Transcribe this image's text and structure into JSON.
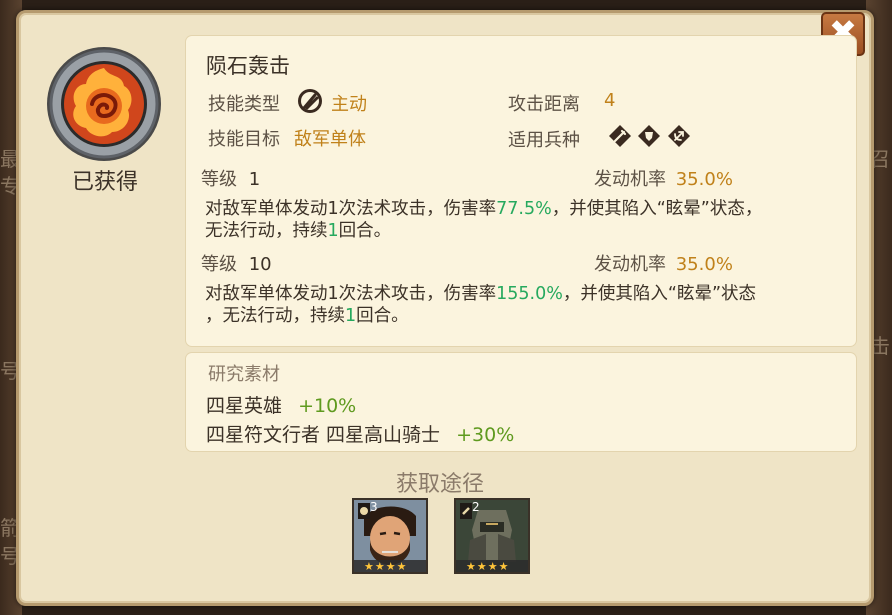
{
  "background": {
    "left_glyphs": [
      "最",
      "专",
      "号",
      "箭",
      "号"
    ],
    "right_glyphs": [
      "召",
      "击"
    ]
  },
  "close": {
    "label": "✖"
  },
  "skill": {
    "status": "已获得",
    "name": "陨石轰击",
    "type_label": "技能类型",
    "type_value": "主动",
    "range_label": "攻击距离",
    "range_value": "4",
    "target_label": "技能目标",
    "target_value": "敌军单体",
    "unit_label": "适用兵种",
    "unit_icons": [
      "sword-icon",
      "shield-icon",
      "bow-icon"
    ]
  },
  "levels": [
    {
      "level_label": "等级",
      "level_value": "1",
      "chance_label": "发动机率",
      "chance_value": "35.0%",
      "desc_a": "对敌军单体发动1次法术攻击，伤害率",
      "desc_rate": "77.5%",
      "desc_b": "，并使其陷入“眩晕”状态，",
      "desc_c": "无法行动，持续",
      "desc_turns": "1",
      "desc_d": "回合。"
    },
    {
      "level_label": "等级",
      "level_value": "10",
      "chance_label": "发动机率",
      "chance_value": "35.0%",
      "desc_a": "对敌军单体发动1次法术攻击，伤害率",
      "desc_rate": "155.0%",
      "desc_b": "，并使其陷入“眩晕”状态",
      "desc_c": "，无法行动，持续",
      "desc_turns": "1",
      "desc_d": "回合。"
    }
  ],
  "materials": {
    "title": "研究素材",
    "rows": [
      {
        "label": "四星英雄",
        "bonus": "+10%"
      },
      {
        "label": "四星符文行者 四星高山骑士",
        "bonus": "+30%"
      }
    ]
  },
  "acquire": {
    "title": "获取途径",
    "heroes": [
      {
        "icon": "bearded-warrior-portrait",
        "badge_number": "3",
        "stars": 4,
        "bg": "#7e8fa0"
      },
      {
        "icon": "armored-knight-portrait",
        "badge_number": "2",
        "stars": 4,
        "bg": "#3c4a3a"
      }
    ]
  },
  "colors": {
    "accent_gold": "#c0811a",
    "value_green": "#26a95e",
    "bonus_green": "#5f9a1f",
    "close_orange": "#b9652f"
  }
}
